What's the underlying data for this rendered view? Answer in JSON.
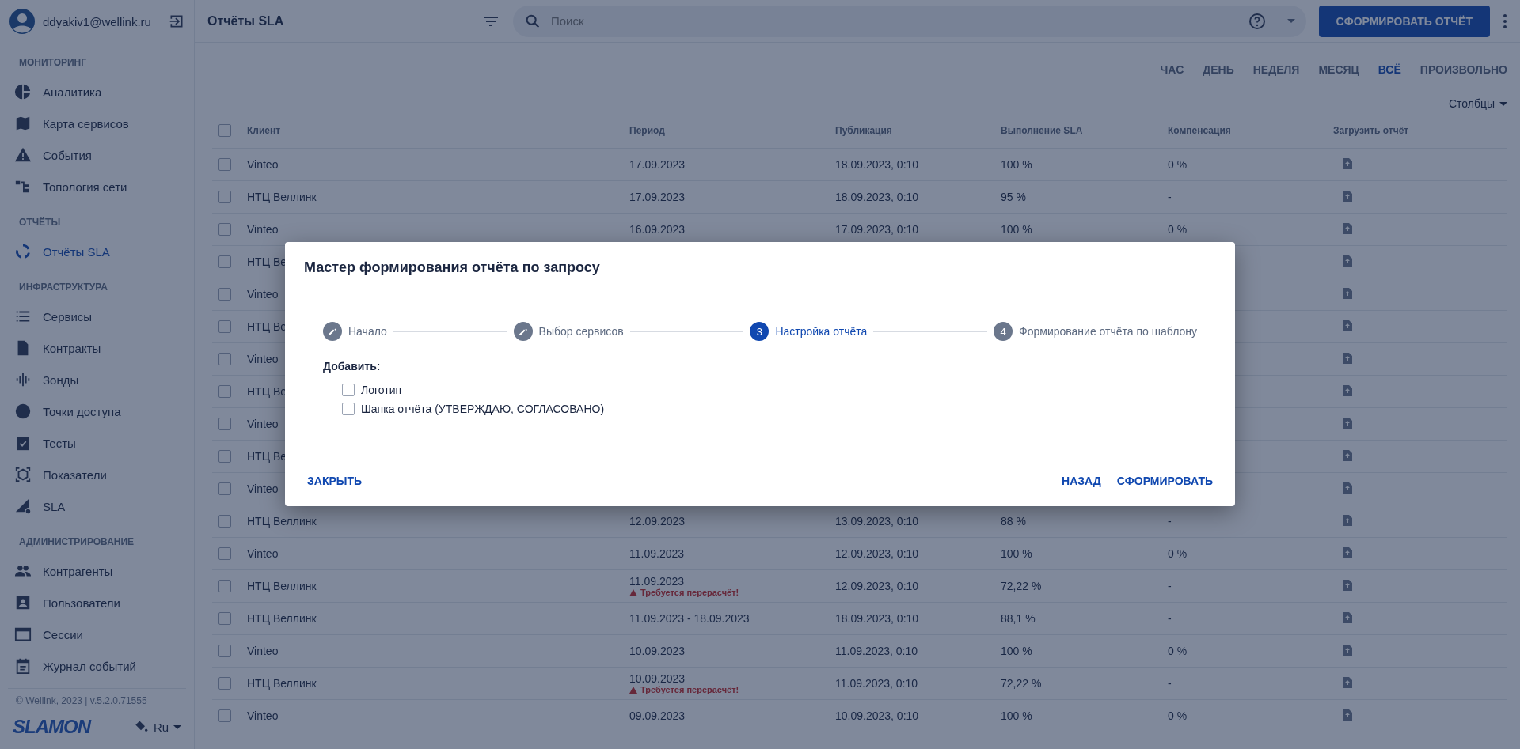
{
  "user": {
    "email": "ddyakiv1@wellink.ru"
  },
  "sidebar": {
    "sections": [
      {
        "title": "МОНИТОРИНГ",
        "items": [
          {
            "label": "Аналитика",
            "selected": false
          },
          {
            "label": "Карта сервисов",
            "selected": false
          },
          {
            "label": "События",
            "selected": false
          },
          {
            "label": "Топология сети",
            "selected": false
          }
        ]
      },
      {
        "title": "ОТЧЁТЫ",
        "items": [
          {
            "label": "Отчёты SLA",
            "selected": true
          }
        ]
      },
      {
        "title": "ИНФРАСТРУКТУРА",
        "items": [
          {
            "label": "Сервисы",
            "selected": false
          },
          {
            "label": "Контракты",
            "selected": false
          },
          {
            "label": "Зонды",
            "selected": false
          },
          {
            "label": "Точки доступа",
            "selected": false
          },
          {
            "label": "Тесты",
            "selected": false
          },
          {
            "label": "Показатели",
            "selected": false
          },
          {
            "label": "SLA",
            "selected": false
          }
        ]
      },
      {
        "title": "АДМИНИСТРИРОВАНИЕ",
        "items": [
          {
            "label": "Контрагенты",
            "selected": false
          },
          {
            "label": "Пользователи",
            "selected": false
          },
          {
            "label": "Сессии",
            "selected": false
          },
          {
            "label": "Журнал событий",
            "selected": false
          }
        ]
      }
    ],
    "footer": "© Wellink, 2023 | v.5.2.0.71555",
    "logo": "SLAMON",
    "language": "Ru"
  },
  "header": {
    "title": "Отчёты SLA",
    "search": {
      "placeholder": "Поиск"
    },
    "primary_button": "СФОРМИРОВАТЬ ОТЧЁТ"
  },
  "periods": [
    {
      "label": "ЧАС",
      "selected": false
    },
    {
      "label": "ДЕНЬ",
      "selected": false
    },
    {
      "label": "НЕДЕЛЯ",
      "selected": false
    },
    {
      "label": "МЕСЯЦ",
      "selected": false
    },
    {
      "label": "ВСЁ",
      "selected": true
    },
    {
      "label": "ПРОИЗВОЛЬНО",
      "selected": false
    }
  ],
  "columns_button": "Столбцы",
  "table": {
    "all_checked": false,
    "columns": [
      "Клиент",
      "Период",
      "Публикация",
      "Выполнение SLA",
      "Компенсация",
      "Загрузить отчёт"
    ],
    "rows": [
      {
        "kind": "full",
        "checked": false,
        "client": "Vinteo",
        "period": "17.09.2023",
        "publication": "18.09.2023, 0:10",
        "sla": "100 %",
        "compensation": "0 %"
      },
      {
        "kind": "full",
        "checked": false,
        "client": "НТЦ Веллинк",
        "period": "17.09.2023",
        "publication": "18.09.2023, 0:10",
        "sla": "95 %",
        "compensation": "-"
      },
      {
        "kind": "full",
        "checked": false,
        "client": "Vinteo",
        "period": "16.09.2023",
        "publication": "17.09.2023, 0:10",
        "sla": "100 %",
        "compensation": "0 %"
      },
      {
        "kind": "covered",
        "checked": false,
        "client": "НТЦ Ве"
      },
      {
        "kind": "covered",
        "checked": false,
        "client": "Vinteo"
      },
      {
        "kind": "covered",
        "checked": false,
        "client": "НТЦ Ве"
      },
      {
        "kind": "covered",
        "checked": false,
        "client": "Vinteo"
      },
      {
        "kind": "covered",
        "checked": false,
        "client": "НТЦ Ве"
      },
      {
        "kind": "covered",
        "checked": false,
        "client": "Vinteo"
      },
      {
        "kind": "covered",
        "checked": false,
        "client": "НТЦ Ве"
      },
      {
        "kind": "covered",
        "checked": false,
        "client": "Vinteo"
      },
      {
        "kind": "full",
        "checked": false,
        "client": "НТЦ Веллинк",
        "period": "12.09.2023",
        "publication": "13.09.2023, 0:10",
        "sla": "88 %",
        "compensation": "-"
      },
      {
        "kind": "full",
        "checked": false,
        "client": "Vinteo",
        "period": "11.09.2023",
        "publication": "12.09.2023, 0:10",
        "sla": "100 %",
        "compensation": "0 %"
      },
      {
        "kind": "full",
        "checked": false,
        "client": "НТЦ Веллинк",
        "period": "11.09.2023",
        "warning": "Требуется перерасчёт!",
        "publication": "12.09.2023, 0:10",
        "sla": "72,22 %",
        "compensation": "-"
      },
      {
        "kind": "full",
        "checked": false,
        "client": "НТЦ Веллинк",
        "period": "11.09.2023 - 18.09.2023",
        "publication": "18.09.2023, 0:10",
        "sla": "88,1 %",
        "compensation": "-"
      },
      {
        "kind": "full",
        "checked": false,
        "client": "Vinteo",
        "period": "10.09.2023",
        "publication": "11.09.2023, 0:10",
        "sla": "100 %",
        "compensation": "0 %"
      },
      {
        "kind": "full",
        "checked": false,
        "client": "НТЦ Веллинк",
        "period": "10.09.2023",
        "warning": "Требуется перерасчёт!",
        "publication": "11.09.2023, 0:10",
        "sla": "72,22 %",
        "compensation": "-"
      },
      {
        "kind": "full",
        "checked": false,
        "client": "Vinteo",
        "period": "09.09.2023",
        "publication": "10.09.2023, 0:10",
        "sla": "100 %",
        "compensation": "0 %"
      }
    ]
  },
  "dialog": {
    "title": "Мастер формирования отчёта по запросу",
    "steps": [
      {
        "label": "Начало",
        "done": true,
        "selected": false
      },
      {
        "label": "Выбор сервисов",
        "done": true,
        "selected": false
      },
      {
        "number": "3",
        "label": "Настройка отчёта",
        "done": false,
        "selected": true
      },
      {
        "number": "4",
        "label": "Формирование отчёта по шаблону",
        "done": false,
        "selected": false
      }
    ],
    "section_label": "Добавить:",
    "options": [
      {
        "label": "Логотип",
        "checked": false
      },
      {
        "label": "Шапка отчёта (УТВЕРЖДАЮ, СОГЛАСОВАНО)",
        "checked": false
      }
    ],
    "buttons": {
      "close": "ЗАКРЫТЬ",
      "back": "НАЗАД",
      "submit": "СФОРМИРОВАТЬ"
    }
  }
}
